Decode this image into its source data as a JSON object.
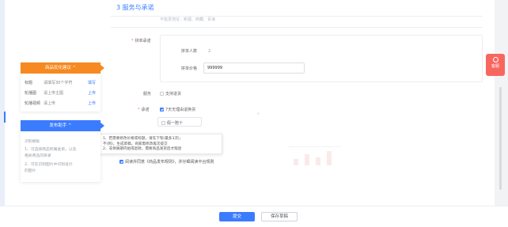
{
  "section": {
    "title": "3 服务与承诺",
    "hint": "不能发地址：新疆、西藏、青海"
  },
  "service": {
    "label": "拼单承诺",
    "count_label": "拼单人数",
    "count_value": "2",
    "price_label": "拼单价格",
    "price_value": "999999"
  },
  "promise": {
    "label": "服务",
    "option_label": "支持退货",
    "sub_label": "承诺",
    "option_checked_label": "7天无理由退换货",
    "option_box_label": "假一赔十"
  },
  "tooltip": {
    "lines": [
      "1、若需要修改价格或标题，请先下架(最多3次)，",
      "不(到)，生成草稿，商家需修改再次提交",
      "2、非保质期内拍或退款，需要商品发货后才能退"
    ]
  },
  "agreement": {
    "text": "阅读并同意《商品发布规则》，并仔细阅读平台规则",
    "link_text": "《商品发布规则》"
  },
  "optimization_panel": {
    "title": "商品优化建议 ^",
    "rows": [
      {
        "name": "标题",
        "desc": "请填写30个字符",
        "action": "填写"
      },
      {
        "name": "轮播图",
        "desc": "请上传主图",
        "action": "上传"
      },
      {
        "name": "轮播视频",
        "desc": "请上传",
        "action": "上传"
      }
    ]
  },
  "publish_panel": {
    "title": "发布助手 ^",
    "lines": [
      "识别模板",
      "1、可选择商品所属类目，以及",
      "相关商品的目录",
      "2、可在识别图片中识别设计",
      "的图片"
    ]
  },
  "feedback": {
    "label": "客服"
  },
  "footer": {
    "submit_label": "提交",
    "draft_label": "保存草稿"
  },
  "colors": {
    "accent": "#3b7cff",
    "orange": "#f6891f",
    "feedback": "#f76760"
  }
}
